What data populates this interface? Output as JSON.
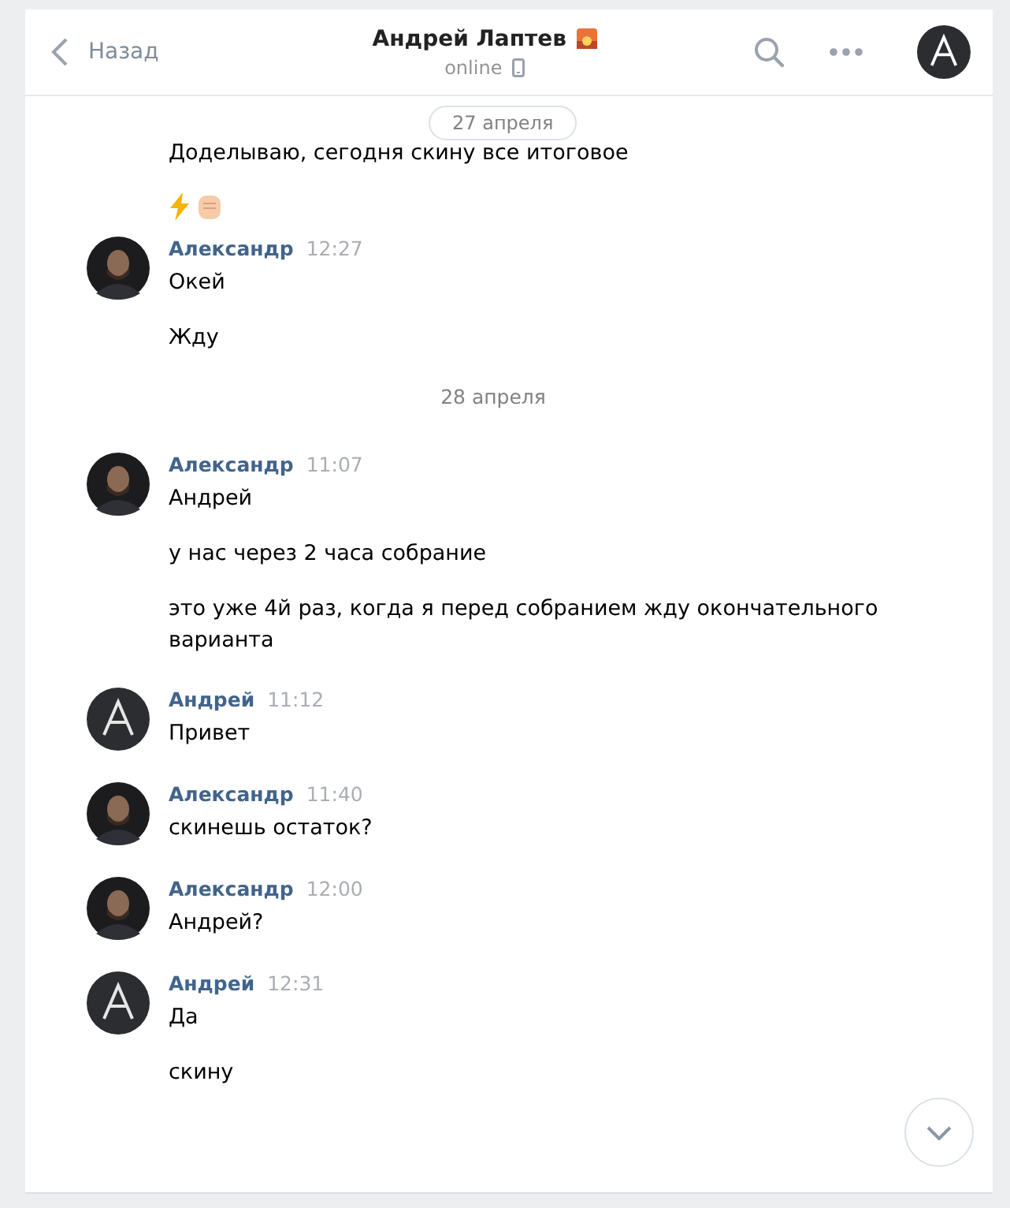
{
  "header": {
    "back": "Назад",
    "title": "Андрей Лаптев",
    "status": "online"
  },
  "date_pill": "27 апреля",
  "feed": [
    {
      "kind": "lines",
      "lines": [
        {
          "kind": "text",
          "text": "Доделываю, сегодня скину все итоговое"
        },
        {
          "kind": "emoji"
        }
      ]
    },
    {
      "kind": "group",
      "avatar": {
        "kind": "photo"
      },
      "author": "Александр",
      "time": "12:27",
      "lines": [
        {
          "kind": "text",
          "text": "Окей"
        },
        {
          "kind": "text",
          "text": "Жду"
        }
      ]
    },
    {
      "kind": "date",
      "text": "28 апреля"
    },
    {
      "kind": "group",
      "avatar": {
        "kind": "photo"
      },
      "author": "Александр",
      "time": "11:07",
      "lines": [
        {
          "kind": "text",
          "text": "Андрей"
        },
        {
          "kind": "text",
          "text": "у нас через 2 часа собрание"
        },
        {
          "kind": "text",
          "text": "это уже 4й раз, когда я перед собранием жду окончательного варианта"
        }
      ]
    },
    {
      "kind": "group",
      "avatar": {
        "kind": "logo"
      },
      "author": "Андрей",
      "time": "11:12",
      "lines": [
        {
          "kind": "text",
          "text": "Привет"
        }
      ]
    },
    {
      "kind": "group",
      "avatar": {
        "kind": "photo"
      },
      "author": "Александр",
      "time": "11:40",
      "lines": [
        {
          "kind": "text",
          "text": "скинешь остаток?"
        }
      ]
    },
    {
      "kind": "group",
      "avatar": {
        "kind": "photo"
      },
      "author": "Александр",
      "time": "12:00",
      "lines": [
        {
          "kind": "text",
          "text": "Андрей?"
        }
      ]
    },
    {
      "kind": "group",
      "avatar": {
        "kind": "logo"
      },
      "author": "Андрей",
      "time": "12:31",
      "lines": [
        {
          "kind": "text",
          "text": "Да"
        },
        {
          "kind": "text",
          "text": "скину"
        }
      ]
    }
  ]
}
